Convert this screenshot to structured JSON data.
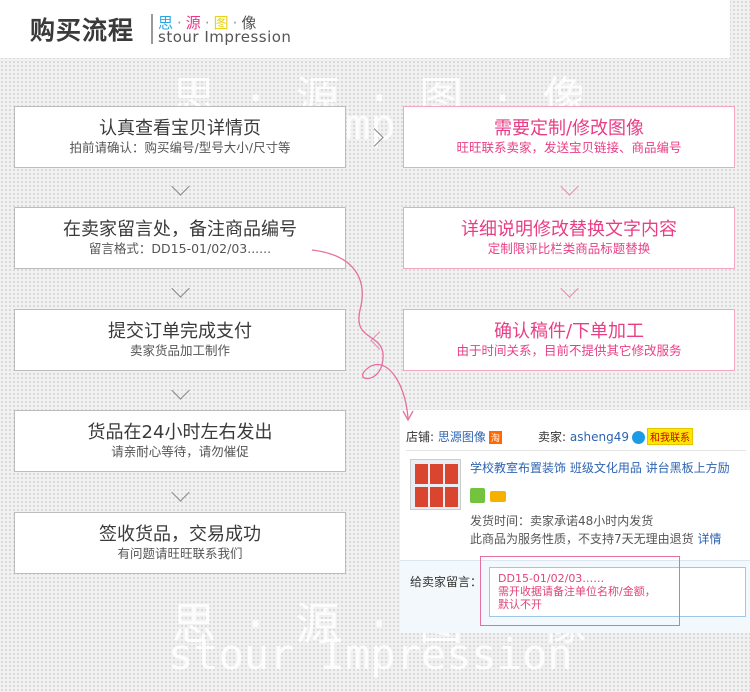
{
  "header": {
    "title": "购买流程",
    "brand_cn": [
      "思",
      "源",
      "图",
      "像"
    ],
    "brand_en": "stour Impression"
  },
  "watermark": {
    "cn": "思 · 源 · 图 · 像",
    "en": "stour Impression"
  },
  "left_steps": [
    {
      "title": "认真查看宝贝详情页",
      "sub": "拍前请确认：购买编号/型号大小/尺寸等"
    },
    {
      "title": "在卖家留言处，备注商品编号",
      "sub": "留言格式：DD15-01/02/03......"
    },
    {
      "title": "提交订单完成支付",
      "sub": "卖家货品加工制作"
    },
    {
      "title": "货品在24小时左右发出",
      "sub": "请亲耐心等待，请勿催促"
    },
    {
      "title": "签收货品，交易成功",
      "sub": "有问题请旺旺联系我们"
    }
  ],
  "right_steps": [
    {
      "title": "需要定制/修改图像",
      "sub": "旺旺联系卖家，发送宝贝链接、商品编号"
    },
    {
      "title": "详细说明修改替换文字内容",
      "sub": "定制限评比栏类商品标题替换"
    },
    {
      "title": "确认稿件/下单加工",
      "sub": "由于时间关系，目前不提供其它修改服务"
    }
  ],
  "shop": {
    "store_label": "店铺:",
    "store_name": "思源图像",
    "store_tag": "淘",
    "seller_label": "卖家:",
    "seller_name": "asheng49",
    "contact_btn": "和我联系",
    "product_title": "学校教室布置装饰 班级文化用品 讲台黑板上方励",
    "ship_time": "发货时间：卖家承诺48小时内发货",
    "service_note": "此商品为服务性质，不支持7天无理由退货",
    "detail_link": "详情",
    "msg_label": "给卖家留言：",
    "msg_text": "DD15-01/02/03……\n需开收据请备注单位名称/金额，\n默认不开"
  },
  "colors": {
    "pink": "#e93e86",
    "blue": "#2e64b1",
    "border_gray": "#bdbdbd"
  }
}
